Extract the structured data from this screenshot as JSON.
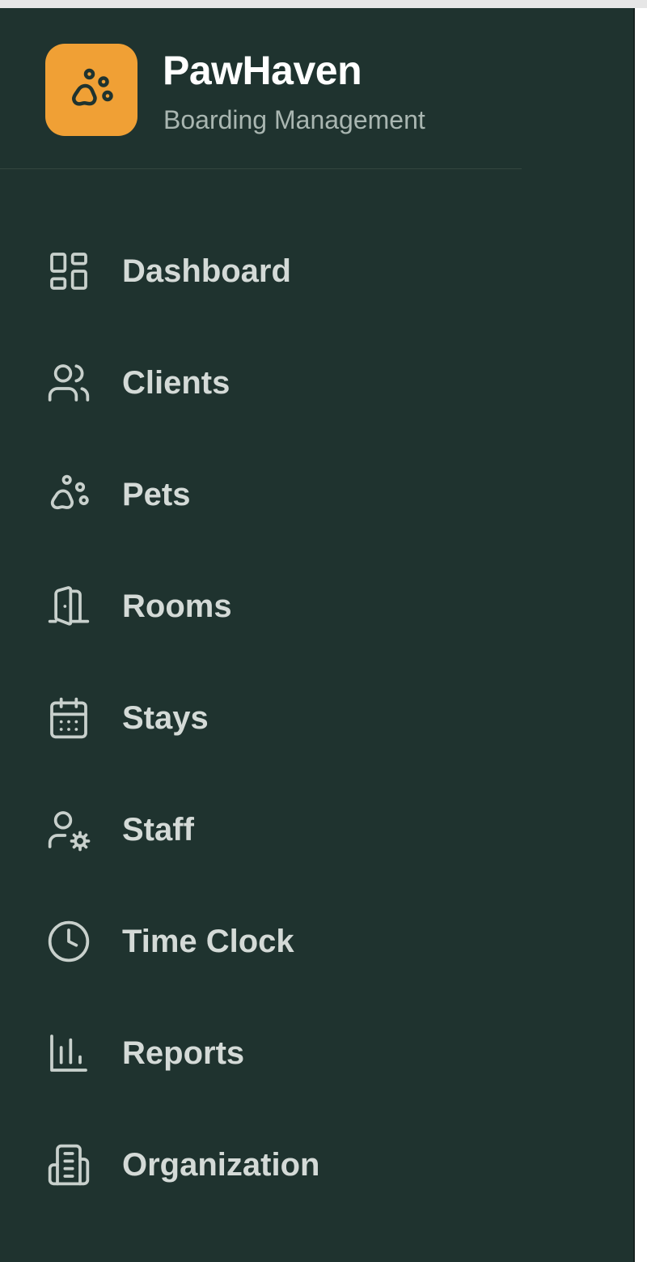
{
  "brand": {
    "name": "PawHaven",
    "subtitle": "Boarding Management",
    "logo_icon": "paw-icon",
    "logo_color": "#f0a035"
  },
  "sidebar": {
    "background": "#1f332f",
    "items": [
      {
        "label": "Dashboard",
        "icon": "dashboard-grid-icon"
      },
      {
        "label": "Clients",
        "icon": "users-icon"
      },
      {
        "label": "Pets",
        "icon": "paw-icon"
      },
      {
        "label": "Rooms",
        "icon": "door-icon"
      },
      {
        "label": "Stays",
        "icon": "calendar-icon"
      },
      {
        "label": "Staff",
        "icon": "user-cog-icon"
      },
      {
        "label": "Time Clock",
        "icon": "clock-icon"
      },
      {
        "label": "Reports",
        "icon": "bar-chart-icon"
      },
      {
        "label": "Organization",
        "icon": "building-icon"
      }
    ]
  }
}
